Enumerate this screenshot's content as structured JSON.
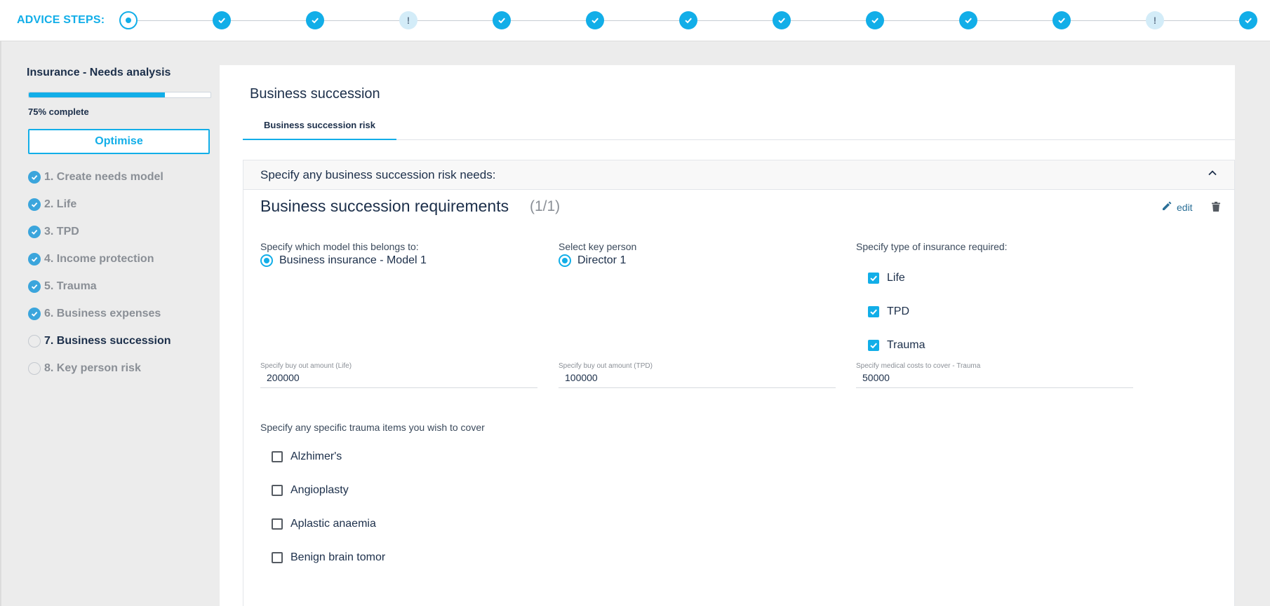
{
  "header": {
    "steps_label": "ADVICE STEPS:",
    "steps": [
      {
        "state": "current"
      },
      {
        "state": "done"
      },
      {
        "state": "done"
      },
      {
        "state": "warn"
      },
      {
        "state": "done"
      },
      {
        "state": "done"
      },
      {
        "state": "done"
      },
      {
        "state": "done"
      },
      {
        "state": "done"
      },
      {
        "state": "done"
      },
      {
        "state": "done"
      },
      {
        "state": "warn"
      },
      {
        "state": "done"
      }
    ],
    "warn_symbol": "!"
  },
  "sidebar": {
    "title": "Insurance - Needs analysis",
    "progress_percent": 75,
    "progress_text": "75% complete",
    "optimise_label": "Optimise",
    "items": [
      {
        "label": "1. Create needs model",
        "state": "done"
      },
      {
        "label": "2. Life",
        "state": "done"
      },
      {
        "label": "3. TPD",
        "state": "done"
      },
      {
        "label": "4. Income protection",
        "state": "done"
      },
      {
        "label": "5. Trauma",
        "state": "done"
      },
      {
        "label": "6. Business expenses",
        "state": "done"
      },
      {
        "label": "7. Business succession",
        "state": "active"
      },
      {
        "label": "8. Key person risk",
        "state": "todo"
      }
    ]
  },
  "main": {
    "title": "Business succession",
    "tab_label": "Business succession risk",
    "section_header": "Specify any business succession risk needs:",
    "requirement_title": "Business succession requirements",
    "requirement_count": "(1/1)",
    "edit_label": "edit",
    "model_label": "Specify which model this belongs to:",
    "model_option": "Business insurance - Model 1",
    "key_person_label": "Select key person",
    "key_person_option": "Director 1",
    "insurance_type_label": "Specify type of insurance required:",
    "insurance_types": [
      "Life",
      "TPD",
      "Trauma"
    ],
    "buyout_life_label": "Specify buy out amount (Life)",
    "buyout_life_value": "200000",
    "buyout_tpd_label": "Specify buy out amount (TPD)",
    "buyout_tpd_value": "100000",
    "medical_costs_label": "Specify medical costs to cover - Trauma",
    "medical_costs_value": "50000",
    "trauma_items_label": "Specify any specific trauma items you wish to cover",
    "trauma_items": [
      "Alzhimer's",
      "Angioplasty",
      "Aplastic anaemia",
      "Benign brain tomor"
    ]
  },
  "colors": {
    "accent": "#12aee8",
    "text_dark": "#1c2f4a",
    "muted": "#8a8f96"
  }
}
